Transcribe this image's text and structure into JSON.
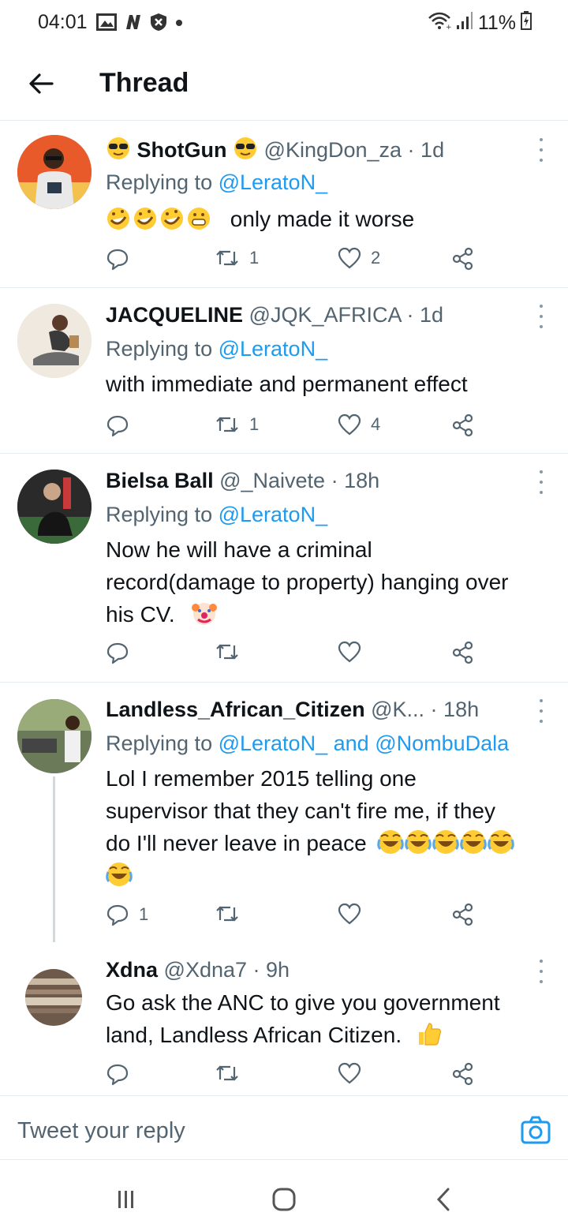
{
  "status_bar": {
    "time": "04:01",
    "battery": "11%"
  },
  "header": {
    "title": "Thread"
  },
  "tweets": [
    {
      "name": "ShotGun",
      "handle": "@KingDon_za",
      "time": "1d",
      "replying_prefix": "Replying to",
      "mention_1": "@LeratoN_",
      "body": "only made it worse",
      "replies": "",
      "retweets": "1",
      "likes": "2"
    },
    {
      "name": "JACQUELINE",
      "handle": "@JQK_AFRICA",
      "time": "1d",
      "replying_prefix": "Replying to",
      "mention_1": "@LeratoN_",
      "body": "with immediate and permanent effect",
      "replies": "",
      "retweets": "1",
      "likes": "4"
    },
    {
      "name": "Bielsa Ball",
      "handle": "@_Naivete",
      "time": "18h",
      "replying_prefix": "Replying to",
      "mention_1": "@LeratoN_",
      "body_line1": "Now he will have a criminal",
      "body_line2": "record(damage to property)  hanging over",
      "body_line3": "his CV.",
      "replies": "",
      "retweets": "",
      "likes": ""
    },
    {
      "name": "Landless_African_Citizen",
      "handle": "@K...",
      "time": "18h",
      "replying_prefix": "Replying to",
      "mention_1": "@LeratoN_",
      "and": "and",
      "mention_2": "@NombuDala",
      "body_line1": "Lol I remember 2015 telling one",
      "body_line2": "supervisor that they can't fire me, if they",
      "body_line3": "do I'll never leave in peace",
      "replies": "1",
      "retweets": "",
      "likes": ""
    },
    {
      "name": "Xdna",
      "handle": "@Xdna7",
      "time": "9h",
      "body_line1": "Go ask the ANC to give you government",
      "body_line2": "land, Landless African Citizen.",
      "replies": "",
      "retweets": "",
      "likes": ""
    }
  ],
  "reply_box": {
    "placeholder": "Tweet your reply"
  },
  "icons": {
    "back": "arrow-left-icon",
    "more": "more-vertical-icon",
    "reply": "comment-icon",
    "retweet": "retweet-icon",
    "like": "heart-icon",
    "share": "share-icon",
    "camera": "camera-icon",
    "wifi": "wifi-icon",
    "signal": "signal-icon",
    "battery": "battery-charging-icon"
  },
  "colors": {
    "accent": "#1d9bf0",
    "secondary_text": "#536471",
    "primary_text": "#0f1419",
    "divider": "#e6ecf0"
  }
}
